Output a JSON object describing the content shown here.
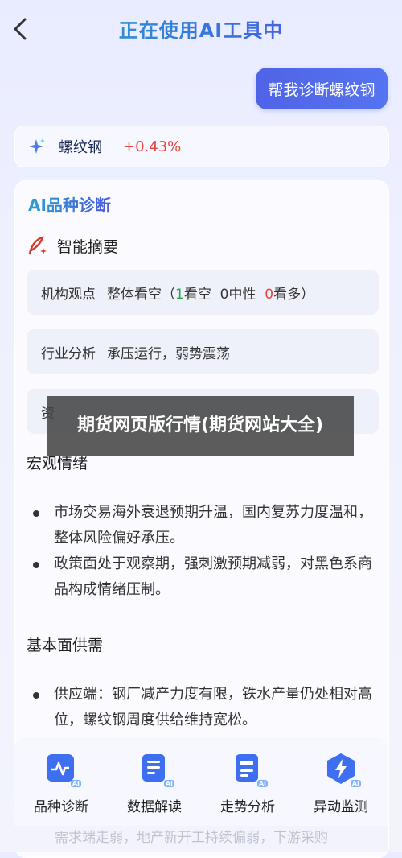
{
  "header": {
    "title": "正在使用AI工具中"
  },
  "chat": {
    "user_message": "帮我诊断螺纹钢"
  },
  "quote": {
    "name": "螺纹钢",
    "change": "+0.43%"
  },
  "diagnosis": {
    "title": "AI品种诊断",
    "summary_label": "智能摘要",
    "rows": [
      {
        "key": "机构观点",
        "value_prefix": "整体看空（",
        "bull": "1",
        "bull_label": "看空",
        "neutral": "0",
        "neutral_label": "中性",
        "bear": "0",
        "bear_label": "看多）"
      },
      {
        "key": "行业分析",
        "value": "承压运行，弱势震荡"
      },
      {
        "key": "资",
        "value": ""
      }
    ],
    "macro": {
      "title": "宏观情绪",
      "bullets": [
        "市场交易海外衰退预期升温，国内复苏力度温和，整体风险偏好承压。",
        "政策面处于观察期，强刺激预期减弱，对黑色系商品构成情绪压制。"
      ]
    },
    "fundamental": {
      "title": "基本面供需",
      "bullets": [
        "供应端：钢厂减产力度有限，铁水产量仍处相对高位，螺纹钢周度供给维持宽松。"
      ],
      "partial_text": "需求端走弱，地产新开工持续偏弱，下游采购"
    }
  },
  "overlay": {
    "text": "期货网页版行情(期货网站大全)"
  },
  "bottom_nav": [
    {
      "label": "品种诊断",
      "icon": "chart-diagnosis-icon"
    },
    {
      "label": "数据解读",
      "icon": "document-icon"
    },
    {
      "label": "走势分析",
      "icon": "trend-doc-icon"
    },
    {
      "label": "异动监测",
      "icon": "lightning-shield-icon"
    }
  ],
  "colors": {
    "accent": "#4f63e6",
    "up": "#e6453d",
    "nav_icon": "#3d6ff0"
  }
}
